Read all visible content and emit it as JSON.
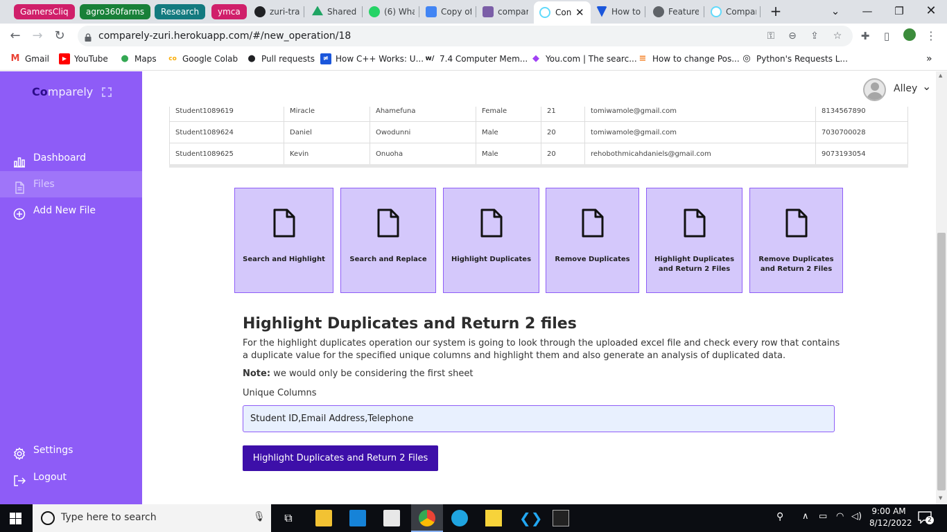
{
  "browser": {
    "group_tabs": [
      {
        "label": "GamersCliq",
        "color": "#d01f6a"
      },
      {
        "label": "agro360farms",
        "color": "#188038"
      },
      {
        "label": "Research",
        "color": "#137a7f"
      },
      {
        "label": "ymca",
        "color": "#d01f6a"
      }
    ],
    "tabs": [
      {
        "label": "zuri-tra",
        "icon_color": "#202124"
      },
      {
        "label": "Shared",
        "icon_color": "#1fa463"
      },
      {
        "label": "(6) Wha",
        "icon_color": "#25d366"
      },
      {
        "label": "Copy of",
        "icon_color": "#4285f4"
      },
      {
        "label": "compar",
        "icon_color": "#7b5ea7"
      },
      {
        "label": "Con",
        "icon_color": "#61dafb",
        "active": true
      },
      {
        "label": "How to",
        "icon_color": "#1a56db"
      },
      {
        "label": "Feature",
        "icon_color": "#5f6368"
      },
      {
        "label": "Compar",
        "icon_color": "#61dafb"
      }
    ],
    "new_tab": "+",
    "url": "comparely-zuri.herokuapp.com/#/new_operation/18",
    "bookmarks": [
      {
        "label": "Gmail",
        "icon_color": "#ea4335",
        "glyph": "M"
      },
      {
        "label": "YouTube",
        "icon_color": "#ff0000",
        "glyph": "▶"
      },
      {
        "label": "Maps",
        "icon_color": "#34a853",
        "glyph": "●"
      },
      {
        "label": "Google Colab",
        "icon_color": "#f9ab00",
        "glyph": "co"
      },
      {
        "label": "Pull requests",
        "icon_color": "#202124",
        "glyph": "●"
      },
      {
        "label": "How C++ Works: U...",
        "icon_color": "#1a56db",
        "glyph": "≠"
      },
      {
        "label": "7.4 Computer Mem...",
        "icon_color": "#ffffff",
        "glyph": "w/"
      },
      {
        "label": "You.com | The searc...",
        "icon_color": "#a142f4",
        "glyph": "◆"
      },
      {
        "label": "How to change Pos...",
        "icon_color": "#f48024",
        "glyph": "≡"
      },
      {
        "label": "Python's Requests L...",
        "icon_color": "#202124",
        "glyph": "◎"
      }
    ]
  },
  "sidebar": {
    "brand_prefix": "Co",
    "brand_rest": "mparely",
    "items": [
      {
        "label": "Dashboard",
        "icon": "bar-chart-icon"
      },
      {
        "label": "Files",
        "icon": "file-icon",
        "active": true
      },
      {
        "label": "Add New File",
        "icon": "plus-circle-icon"
      }
    ],
    "bottom_items": [
      {
        "label": "Settings",
        "icon": "gear-icon"
      },
      {
        "label": "Logout",
        "icon": "logout-icon"
      }
    ]
  },
  "header": {
    "user_name": "Alley"
  },
  "table": {
    "rows": [
      [
        "Student1089619",
        "Miracle",
        "Ahamefuna",
        "Female",
        "21",
        "tomiwamole@gmail.com",
        "8134567890"
      ],
      [
        "Student1089624",
        "Daniel",
        "Owodunni",
        "Male",
        "20",
        "tomiwamole@gmail.com",
        "7030700028"
      ],
      [
        "Student1089625",
        "Kevin",
        "Onuoha",
        "Male",
        "20",
        "rehobothmicahdaniels@gmail.com",
        "9073193054"
      ]
    ]
  },
  "operations": [
    {
      "label": "Search and Highlight"
    },
    {
      "label": "Search and Replace"
    },
    {
      "label": "Highlight Duplicates"
    },
    {
      "label": "Remove Duplicates"
    },
    {
      "label": "Highlight Duplicates and Return 2 Files"
    },
    {
      "label": "Remove Duplicates and Return 2 Files"
    }
  ],
  "section": {
    "title": "Highlight Duplicates and Return 2 files",
    "description": "For the highlight duplicates operation our system is going to look through the uploaded excel file and check every row that contains a duplicate value for the specified unique columns and highlight them and also generate an analysis of duplicated data.",
    "note_label": "Note:",
    "note_text": "we would only be considering the first sheet",
    "input_label": "Unique Columns",
    "input_value": "Student ID,Email Address,Telephone",
    "button_label": "Highlight Duplicates and Return 2 Files"
  },
  "taskbar": {
    "search_placeholder": "Type here to search",
    "time": "9:00 AM",
    "date": "8/12/2022",
    "notification_count": "2"
  },
  "colors": {
    "sidebar": "#8e5cf7",
    "card": "#d4c8fb",
    "button": "#3d0fa9"
  }
}
